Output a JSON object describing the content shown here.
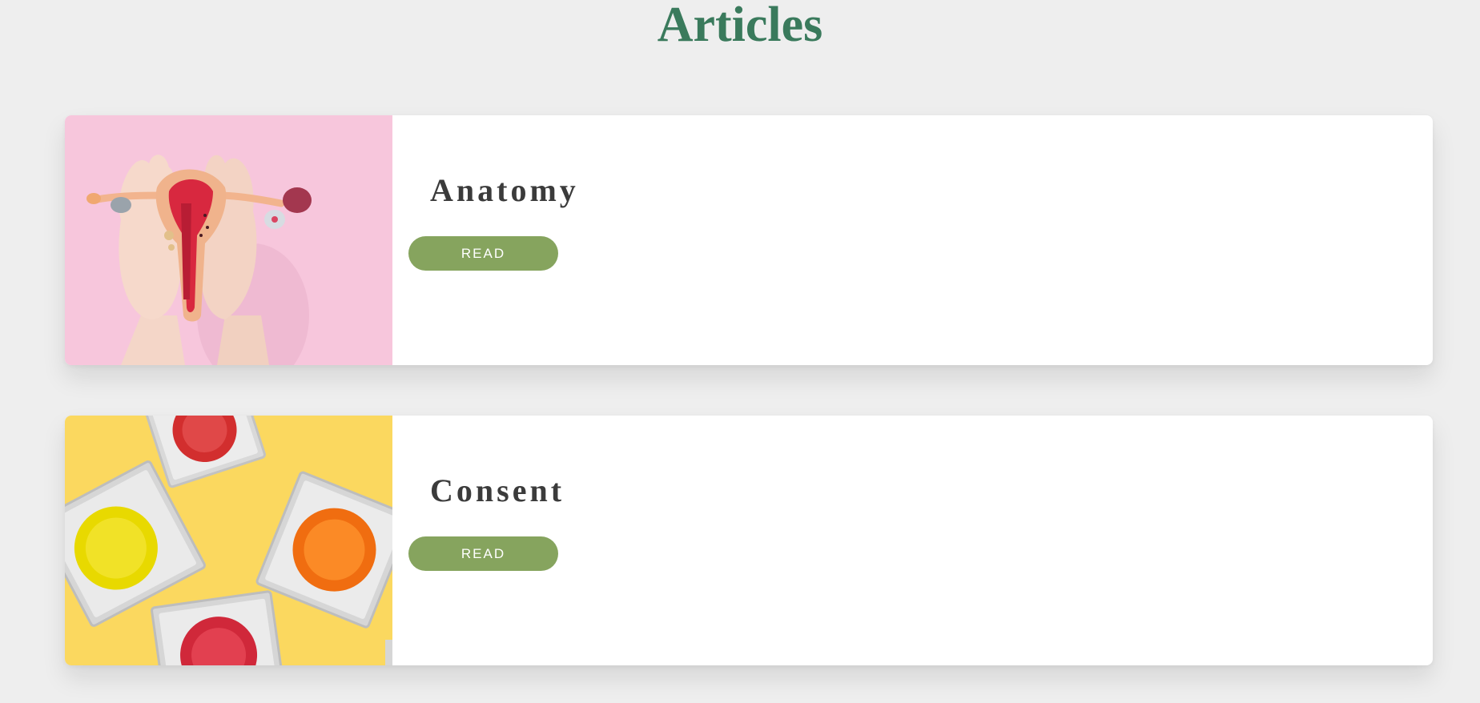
{
  "page": {
    "title": "Articles"
  },
  "articles": [
    {
      "title": "Anatomy",
      "button_label": "READ",
      "image": "uterus-model-illustration",
      "image_bg": "#f7c6dc"
    },
    {
      "title": "Consent",
      "button_label": "READ",
      "image": "condoms-illustration",
      "image_bg": "#fbd85f"
    }
  ],
  "colors": {
    "background": "#eeeeee",
    "title": "#3a7a5c",
    "button": "#86a45e",
    "card_title": "#3b3b3b"
  }
}
